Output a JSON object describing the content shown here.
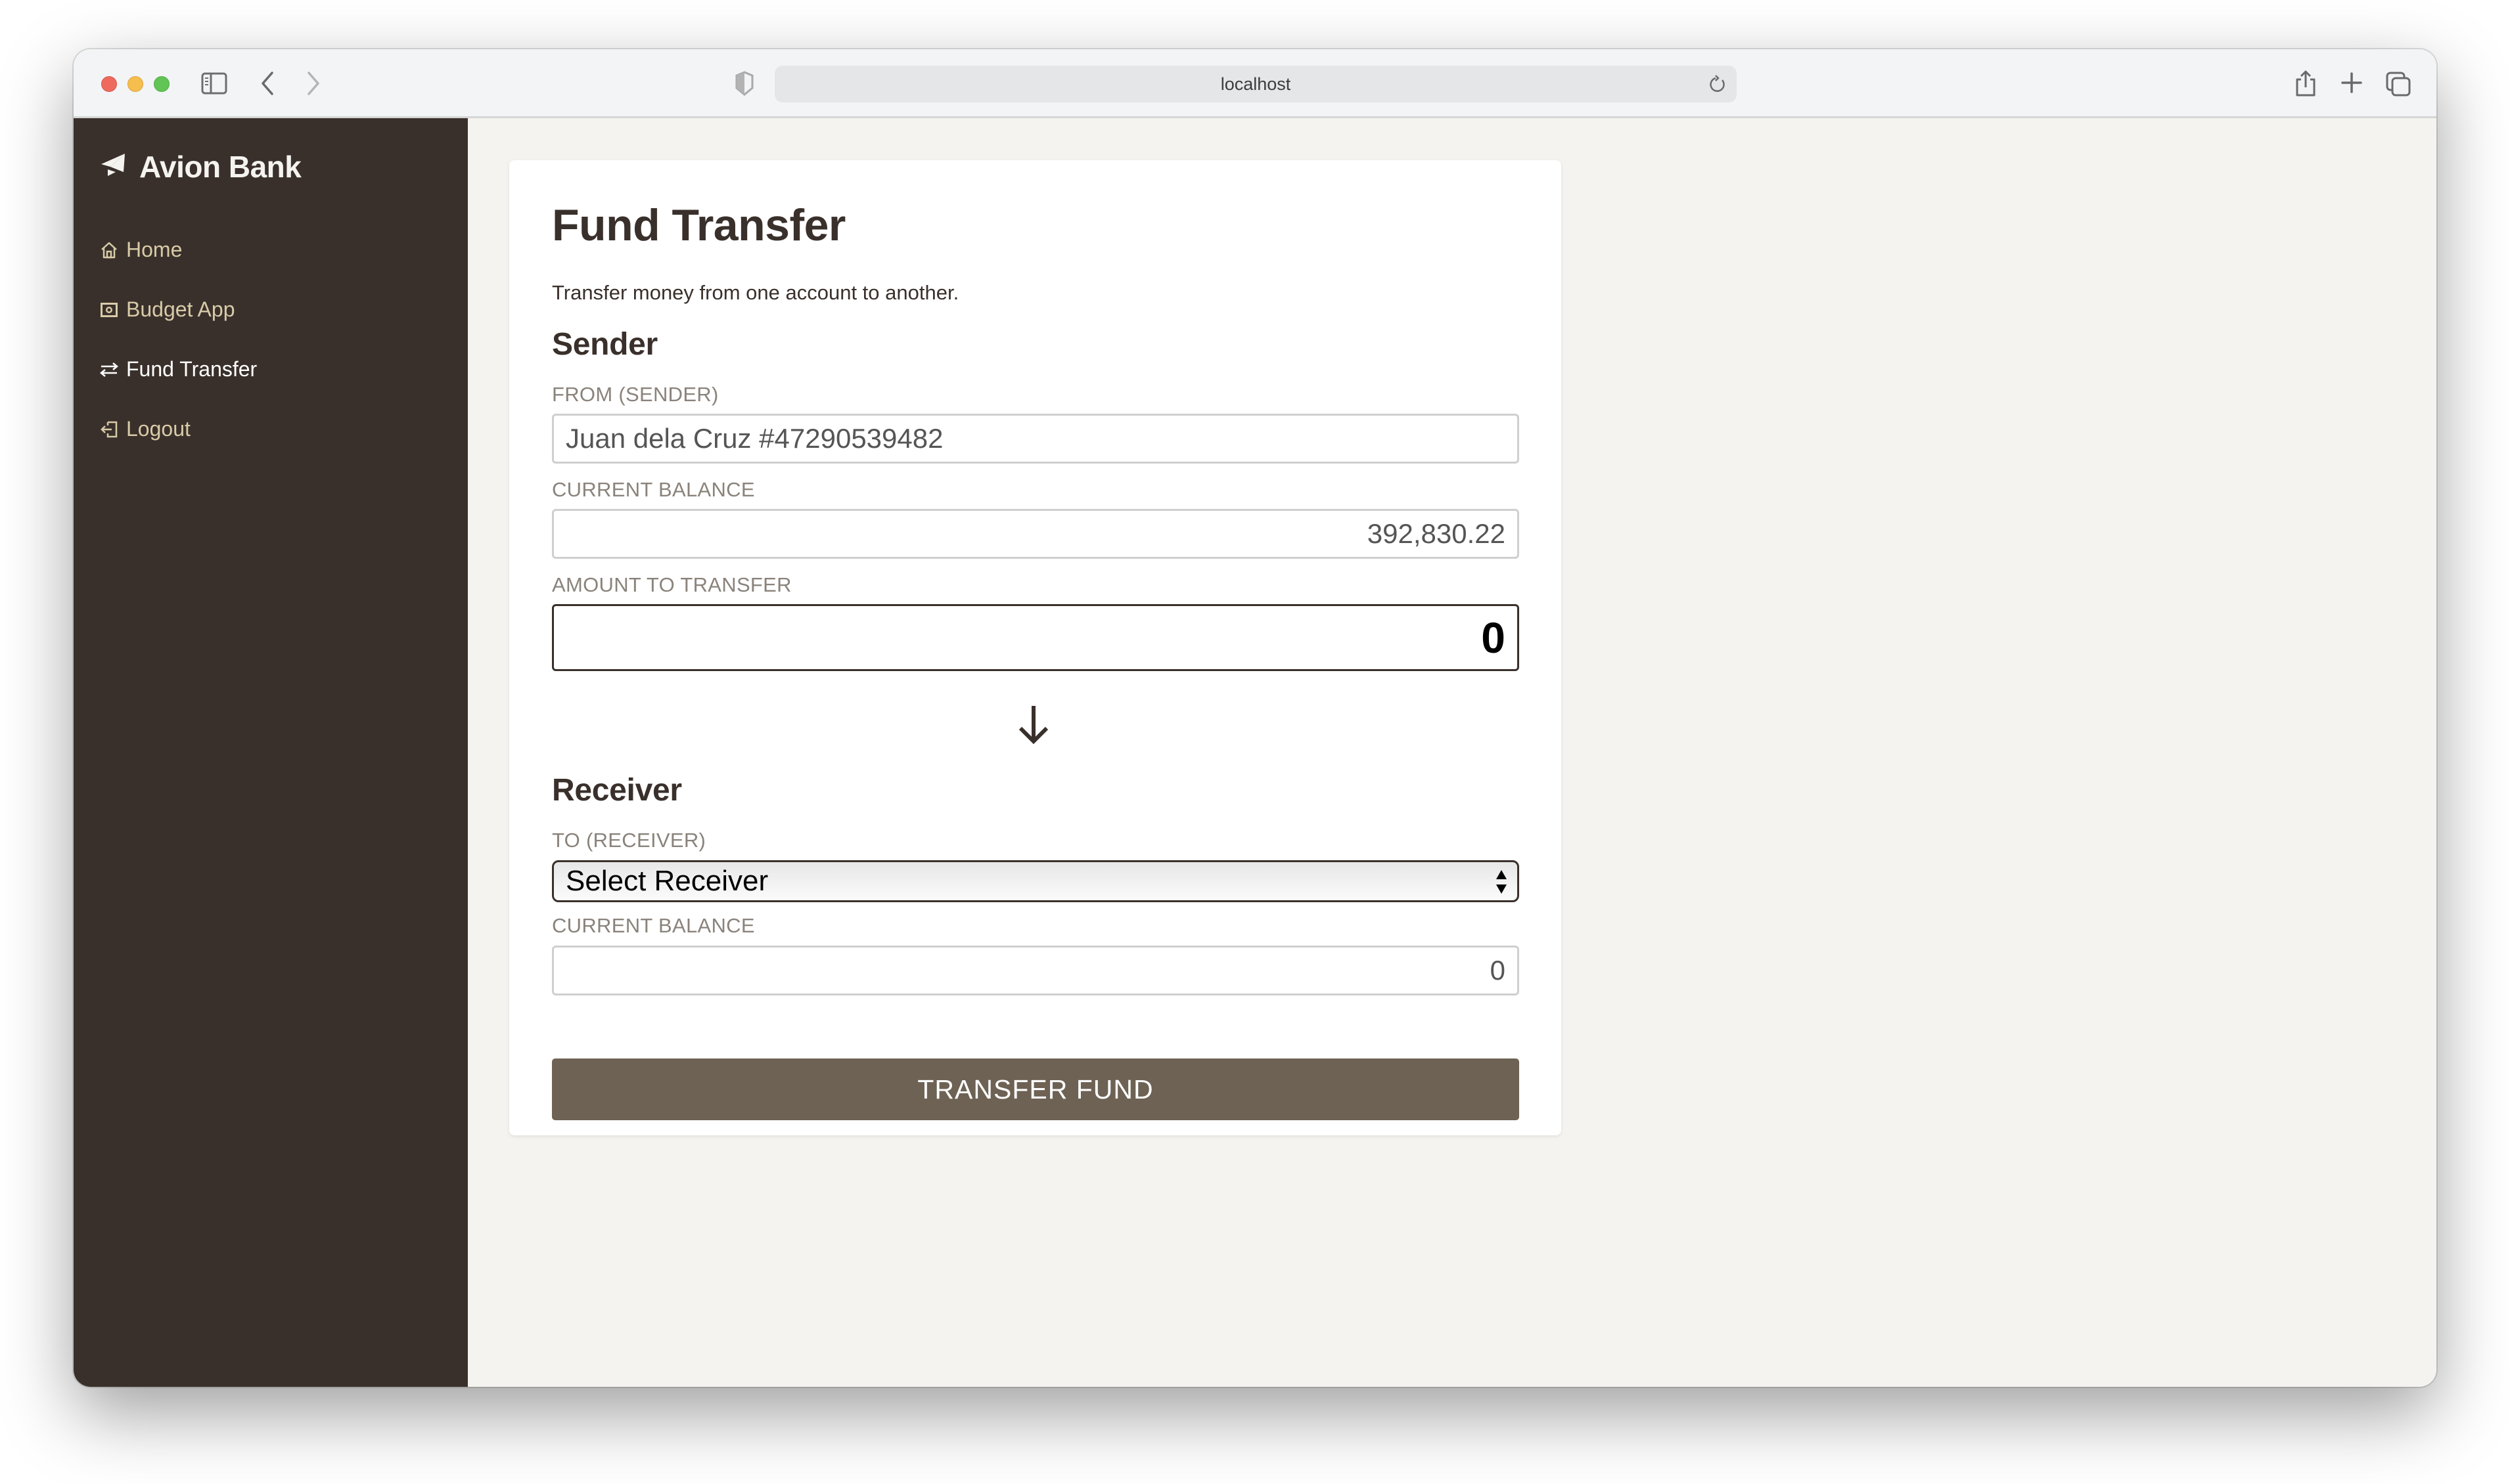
{
  "browser": {
    "url": "localhost",
    "icons": {
      "sidebar_toggle": "sidebar-toggle-icon",
      "back": "chevron-left-icon",
      "forward": "chevron-right-icon",
      "privacy": "shield-icon",
      "reload": "reload-icon",
      "share": "share-icon",
      "new_tab": "plus-icon",
      "tab_overview": "tabs-icon"
    }
  },
  "sidebar": {
    "brand": "Avion Bank",
    "brand_icon": "paper-plane-icon",
    "items": [
      {
        "label": "Home",
        "icon": "home-icon",
        "active": false
      },
      {
        "label": "Budget App",
        "icon": "money-icon",
        "active": false
      },
      {
        "label": "Fund Transfer",
        "icon": "transfer-arrows-icon",
        "active": true
      },
      {
        "label": "Logout",
        "icon": "logout-icon",
        "active": false
      }
    ]
  },
  "main": {
    "title": "Fund Transfer",
    "description": "Transfer money from one account to another.",
    "sender": {
      "heading": "Sender",
      "from_label": "FROM (SENDER)",
      "from_value": "Juan dela Cruz #47290539482",
      "balance_label": "CURRENT BALANCE",
      "balance_value": "392,830.22",
      "amount_label": "AMOUNT TO TRANSFER",
      "amount_value": "0"
    },
    "direction_icon": "arrow-down-icon",
    "receiver": {
      "heading": "Receiver",
      "to_label": "TO (RECEIVER)",
      "to_selected": "Select Receiver",
      "balance_label": "CURRENT BALANCE",
      "balance_value": "0"
    },
    "submit_label": "TRANSFER FUND"
  },
  "colors": {
    "sidebar_bg": "#3a302b",
    "sidebar_text": "#d8cba8",
    "page_bg": "#f4f3ef",
    "button_bg": "#6d6254",
    "heading": "#3a302b"
  }
}
